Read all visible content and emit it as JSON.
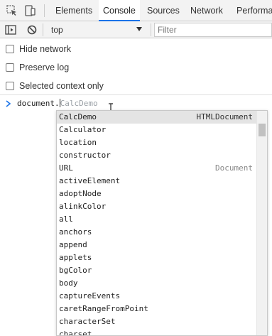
{
  "tabs": {
    "items": [
      "Elements",
      "Console",
      "Sources",
      "Network",
      "Performa"
    ],
    "active": "Console"
  },
  "toolbar": {
    "context_value": "top",
    "filter_placeholder": "Filter"
  },
  "settings": [
    {
      "label": "Hide network",
      "checked": false
    },
    {
      "label": "Preserve log",
      "checked": false
    },
    {
      "label": "Selected context only",
      "checked": false
    }
  ],
  "console": {
    "typed": "document.",
    "ghost_completion": "CalcDemo"
  },
  "suggestions": [
    {
      "name": "CalcDemo",
      "type": "HTMLDocument"
    },
    {
      "name": "Calculator",
      "type": ""
    },
    {
      "name": "location",
      "type": ""
    },
    {
      "name": "constructor",
      "type": ""
    },
    {
      "name": "URL",
      "type": "Document"
    },
    {
      "name": "activeElement",
      "type": ""
    },
    {
      "name": "adoptNode",
      "type": ""
    },
    {
      "name": "alinkColor",
      "type": ""
    },
    {
      "name": "all",
      "type": ""
    },
    {
      "name": "anchors",
      "type": ""
    },
    {
      "name": "append",
      "type": ""
    },
    {
      "name": "applets",
      "type": ""
    },
    {
      "name": "bgColor",
      "type": ""
    },
    {
      "name": "body",
      "type": ""
    },
    {
      "name": "captureEvents",
      "type": ""
    },
    {
      "name": "caretRangeFromPoint",
      "type": ""
    },
    {
      "name": "characterSet",
      "type": ""
    },
    {
      "name": "charset",
      "type": ""
    }
  ],
  "colors": {
    "accent": "#1a73e8",
    "prompt": "#1a73e8",
    "selected_row": "#e4e4e4"
  }
}
